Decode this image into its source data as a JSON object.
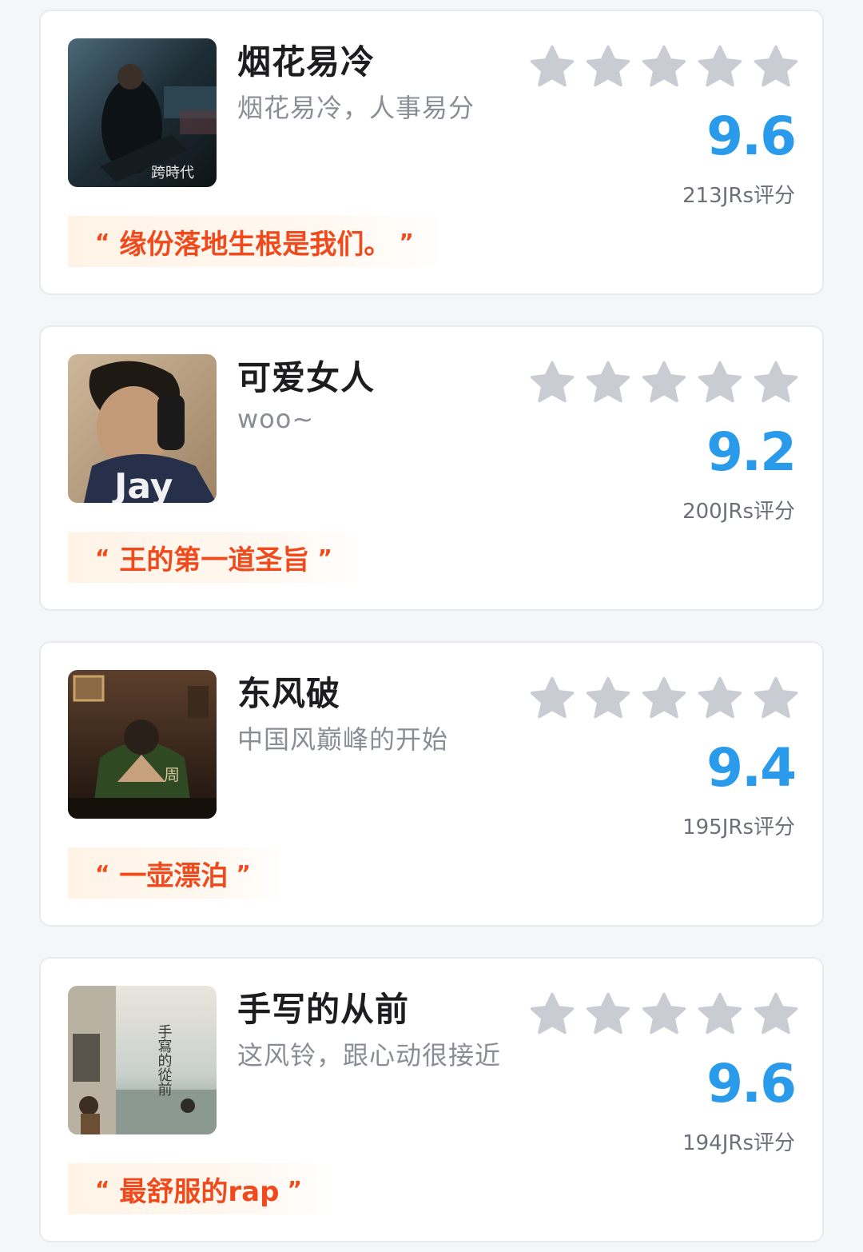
{
  "colors": {
    "score": "#2a9bea",
    "quote_text": "#f04a1c",
    "quote_bg": "#fff3e6",
    "star": "#c9ccd3"
  },
  "songs": [
    {
      "title": "烟花易冷",
      "subtitle": "烟花易冷，人事易分",
      "score": "9.6",
      "count": "213JRs评分",
      "quote": "缘份落地生根是我们。",
      "quote_open": "“",
      "quote_close": "”",
      "cover_text": "跨時代",
      "stars_filled": 0
    },
    {
      "title": "可爱女人",
      "subtitle": "woo~",
      "score": "9.2",
      "count": "200JRs评分",
      "quote": "王的第一道圣旨",
      "quote_open": "“",
      "quote_close": "”",
      "cover_text": "Jay",
      "stars_filled": 0
    },
    {
      "title": "东风破",
      "subtitle": "中国风巅峰的开始",
      "score": "9.4",
      "count": "195JRs评分",
      "quote": "一壶漂泊",
      "quote_open": "“",
      "quote_close": "”",
      "cover_text": "周",
      "stars_filled": 0
    },
    {
      "title": "手写的从前",
      "subtitle": "这风铃，跟心动很接近",
      "score": "9.6",
      "count": "194JRs评分",
      "quote": "最舒服的rap",
      "quote_open": "“",
      "quote_close": "”",
      "cover_text": "手寫的從前",
      "stars_filled": 0
    }
  ]
}
